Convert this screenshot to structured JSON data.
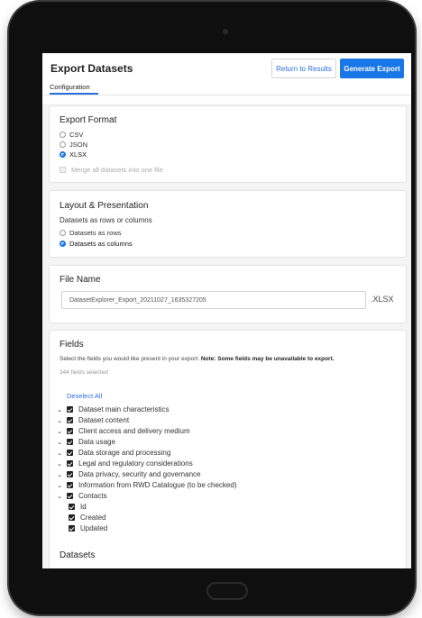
{
  "header": {
    "title": "Export Datasets",
    "return_button": "Return to Results",
    "generate_button": "Generate Export",
    "tab": "Configuration"
  },
  "export_format": {
    "title": "Export Format",
    "options": [
      {
        "label": "CSV",
        "selected": false
      },
      {
        "label": "JSON",
        "selected": false
      },
      {
        "label": "XLSX",
        "selected": true
      }
    ],
    "merge_label": "Merge all datasets into one file"
  },
  "layout": {
    "title": "Layout & Presentation",
    "subtitle": "Datasets as rows or columns",
    "options": [
      {
        "label": "Datasets as rows",
        "selected": false
      },
      {
        "label": "Datasets as columns",
        "selected": true
      }
    ]
  },
  "file_name": {
    "title": "File Name",
    "value": "DatasetExplorer_Export_20211027_1635327205",
    "extension": ".XLSX"
  },
  "fields": {
    "title": "Fields",
    "description": "Select the fields you would like present in your export.",
    "note": "Note: Some fields may be unavailable to export.",
    "count": "344 fields selected",
    "deselect": "Deselect All",
    "groups": [
      "Dataset main characteristics",
      "Dataset content",
      "Client access and delivery medium",
      "Data usage",
      "Data storage and processing",
      "Legal and regulatory considerations",
      "Data privacy, security and governance",
      "Information from RWD Catalogue (to be checked)",
      "Contacts"
    ],
    "contacts_children": [
      "Id",
      "Created",
      "Updated"
    ]
  },
  "datasets": {
    "title": "Datasets"
  },
  "colors": {
    "accent": "#1976e6",
    "link": "#2a6de0",
    "background": "#f4f4f4"
  }
}
